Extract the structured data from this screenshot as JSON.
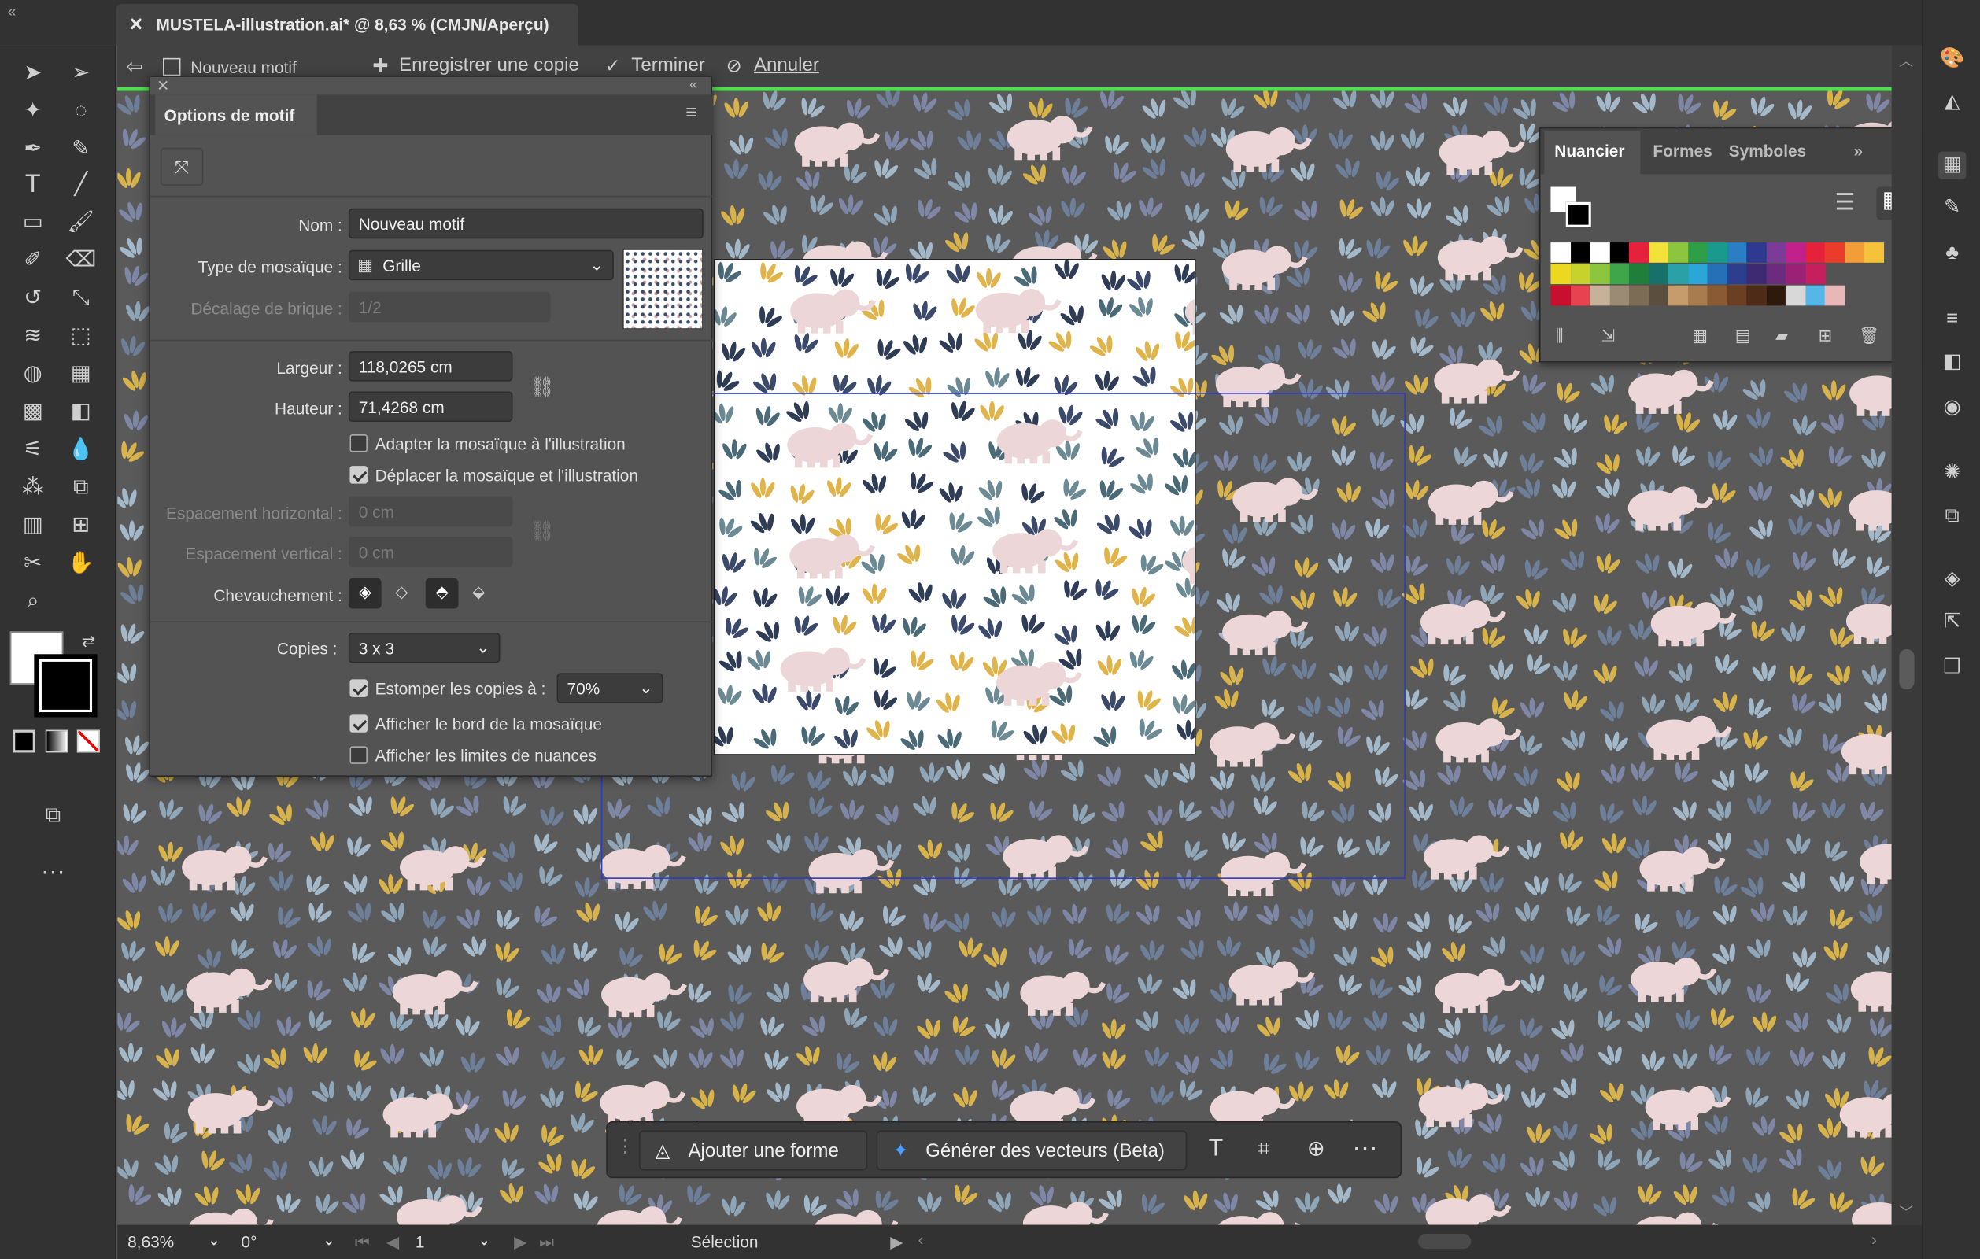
{
  "window": {
    "doc_tab_title": "MUSTELA-illustration.ai* @ 8,63 % (CMJN/Aperçu)",
    "collapse_left": "«"
  },
  "pattern_bar": {
    "mode_label": "Nouveau motif",
    "save_copy": "Enregistrer une copie",
    "finish": "Terminer",
    "cancel": "Annuler"
  },
  "pattern_options": {
    "panel_title": "Options de motif",
    "name_label": "Nom :",
    "name_value": "Nouveau motif",
    "tile_type_label": "Type de mosaïque :",
    "tile_type_value": "Grille",
    "brick_offset_label": "Décalage de brique :",
    "brick_offset_value": "1/2",
    "width_label": "Largeur :",
    "width_value": "118,0265 cm",
    "height_label": "Hauteur :",
    "height_value": "71,4268 cm",
    "size_tile_label": "Adapter la mosaïque à l'illustration",
    "size_tile_checked": false,
    "move_tile_label": "Déplacer la mosaïque et l'illustration",
    "move_tile_checked": true,
    "h_spacing_label": "Espacement horizontal :",
    "h_spacing_value": "0 cm",
    "v_spacing_label": "Espacement vertical :",
    "v_spacing_value": "0 cm",
    "overlap_label": "Chevauchement :",
    "copies_label": "Copies :",
    "copies_value": "3 x 3",
    "dim_copies_label": "Estomper les copies à :",
    "dim_copies_checked": true,
    "dim_copies_value": "70%",
    "show_tile_edge_label": "Afficher le bord de la mosaïque",
    "show_tile_edge_checked": true,
    "show_swatch_bounds_label": "Afficher les limites de nuances",
    "show_swatch_bounds_checked": false
  },
  "swatches_panel": {
    "tabs": [
      "Nuancier",
      "Formes",
      "Symboles"
    ],
    "active_tab": "Nuancier",
    "expand": "»",
    "rows": [
      [
        "#ffffff",
        "#000000",
        "#ffffff",
        "#000000",
        "#e5213b",
        "#f2e23a",
        "#8cc63f",
        "#2f9f47",
        "#1a9a8c",
        "#2a7ec4",
        "#2e3a8f",
        "#7a3c96",
        "#c2208a",
        "#e5213b",
        "#ea3c2a",
        "#f29d38",
        "#f6c23c"
      ],
      [
        "#ecd81f",
        "#c8d22d",
        "#8cc63f",
        "#3fa64a",
        "#1e7e3a",
        "#17706a",
        "#2ba0a6",
        "#2aa7d8",
        "#2670b8",
        "#2b3f8e",
        "#3e2a73",
        "#6b2b7e",
        "#9b2176",
        "#c51f5d"
      ],
      [
        "#c8102e",
        "#e8414f",
        "#c7b299",
        "#9c8b74",
        "#7c6c55",
        "#5b4e3e",
        "#c69c6d",
        "#a87c4f",
        "#8a5a35",
        "#6b3f23",
        "#4e2b16",
        "#2e1a0c",
        "#d8d8d8",
        "#55b6e8",
        "#e8b7b7"
      ]
    ]
  },
  "contextual_bar": {
    "add_shape": "Ajouter une forme",
    "generate_vectors": "Générer des vecteurs (Beta)"
  },
  "status_bar": {
    "zoom": "8,63%",
    "rotation": "0°",
    "artboard": "1",
    "tool": "Sélection"
  }
}
